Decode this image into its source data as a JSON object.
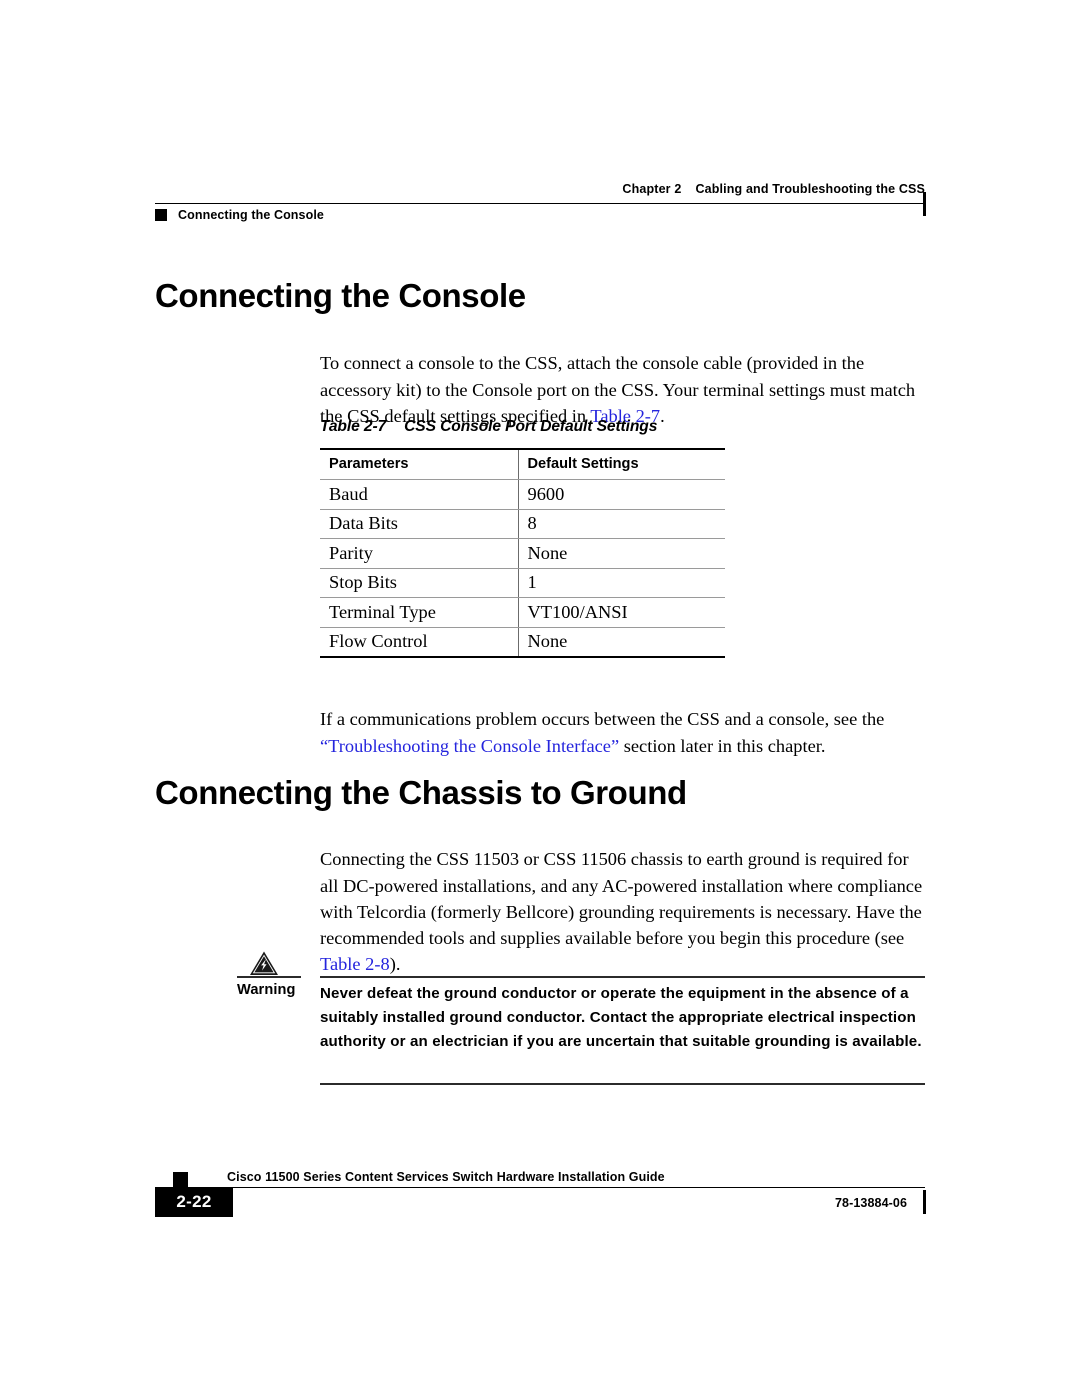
{
  "header": {
    "chapter_label": "Chapter 2",
    "chapter_title": "Cabling and Troubleshooting the CSS",
    "running_section": "Connecting the Console"
  },
  "sections": {
    "console": {
      "title": "Connecting the Console",
      "intro_before_xref": "To connect a console to the CSS, attach the console cable (provided in the accessory kit) to the Console port on the CSS. Your terminal settings must match the CSS default settings specified in ",
      "intro_xref": "Table 2-7",
      "intro_after_xref": ".",
      "after_table_before_xref": "If a communications problem occurs between the CSS and a console, see the ",
      "after_table_xref": "“Troubleshooting the Console Interface”",
      "after_table_after_xref": " section later in this chapter."
    },
    "ground": {
      "title": "Connecting the Chassis to Ground",
      "intro_before_xref": "Connecting the CSS 11503 or CSS 11506 chassis to earth ground is required for all DC-powered installations, and any AC-powered installation where compliance with Telcordia (formerly Bellcore) grounding requirements is necessary. Have the recommended tools and supplies available before you begin this procedure (see ",
      "intro_xref": "Table 2-8",
      "intro_after_xref": ")."
    }
  },
  "table": {
    "caption_number": "Table 2-7",
    "caption_title": "CSS Console Port Default Settings",
    "columns": [
      "Parameters",
      "Default Settings"
    ],
    "rows": [
      [
        "Baud",
        "9600"
      ],
      [
        "Data Bits",
        "8"
      ],
      [
        "Parity",
        "None"
      ],
      [
        "Stop Bits",
        "1"
      ],
      [
        "Terminal Type",
        "VT100/ANSI"
      ],
      [
        "Flow Control",
        "None"
      ]
    ]
  },
  "warning": {
    "label": "Warning",
    "icon": "warning-lightning-triangle-icon",
    "text": "Never defeat the ground conductor or operate the equipment in the absence of a suitably installed ground conductor. Contact the appropriate electrical inspection authority or an electrician if you are uncertain that suitable grounding is available."
  },
  "footer": {
    "doc_title": "Cisco 11500 Series Content Services Switch Hardware Installation Guide",
    "page_number": "2-22",
    "doc_number": "78-13884-06"
  },
  "colors": {
    "text": "#000000",
    "xref_link": "#2424dd",
    "rule_dark": "#000000",
    "rule_light": "#9a9a9a"
  }
}
